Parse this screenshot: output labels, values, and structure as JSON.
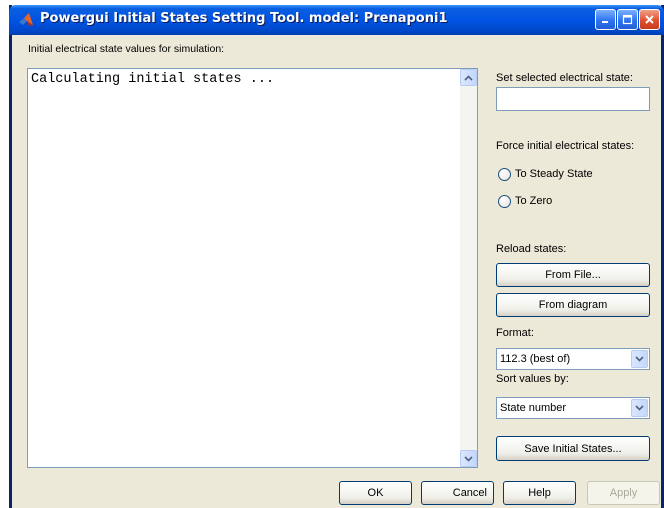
{
  "window": {
    "title": "Powergui Initial States Setting Tool.  model: Prenaponi1"
  },
  "list": {
    "label": "Initial electrical state values for simulation:",
    "lines": [
      "Calculating initial states ..."
    ]
  },
  "right_panel": {
    "set_state_label": "Set selected electrical state:",
    "set_state_value": "",
    "force_label": "Force initial electrical states:",
    "radio_steady": "To Steady State",
    "radio_zero": "To Zero",
    "reload_label": "Reload states:",
    "from_file": "From File...",
    "from_diagram": "From diagram",
    "format_label": "Format:",
    "format_value": "112.3 (best of)",
    "sort_label": "Sort values by:",
    "sort_value": "State number",
    "save_button": "Save Initial States..."
  },
  "footer": {
    "ok": "OK",
    "cancel": "Cancel",
    "help": "Help",
    "apply": "Apply"
  },
  "colors": {
    "titlebar": "#0054e3",
    "window_bg": "#ece9d8",
    "border": "#7f9db9"
  }
}
